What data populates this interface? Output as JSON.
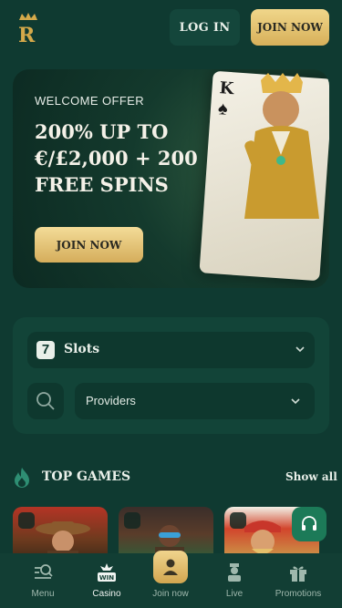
{
  "header": {
    "login_label": "LOG IN",
    "join_label": "JOIN NOW"
  },
  "banner": {
    "offer_label": "WELCOME OFFER",
    "title_line1": "200% UP TO",
    "title_line2": "€/£2,000 + 200",
    "title_line3": "FREE SPINS",
    "button_label": "JOIN NOW",
    "card_rank": "K"
  },
  "filters": {
    "category_label": "Slots",
    "category_icon_glyph": "7",
    "providers_label": "Providers"
  },
  "top_games": {
    "title": "TOP GAMES",
    "show_all_label": "Show all"
  },
  "nav": {
    "items": [
      {
        "label": "Menu",
        "icon": "search-menu-icon"
      },
      {
        "label": "Casino",
        "icon": "win-icon"
      },
      {
        "label": "Join now",
        "icon": "user-icon"
      },
      {
        "label": "Live",
        "icon": "dealer-icon"
      },
      {
        "label": "Promotions",
        "icon": "gift-icon"
      }
    ],
    "active": "Casino"
  },
  "colors": {
    "background": "#0f3a31",
    "gold": "#d7b05a",
    "panel": "#124438",
    "support": "#1c7a58"
  }
}
